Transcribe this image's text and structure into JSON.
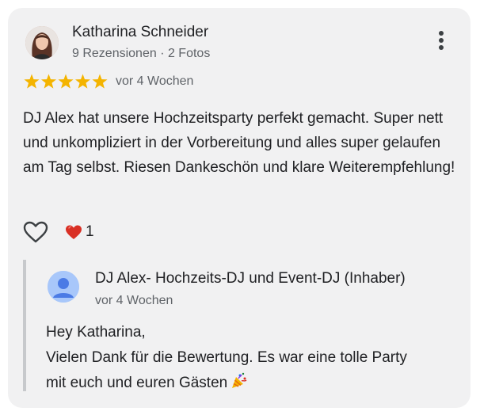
{
  "review": {
    "author_name": "Katharina Schneider",
    "author_meta": "9 Rezensionen · 2 Fotos",
    "rating": 5,
    "rating_max": 5,
    "date": "vor 4 Wochen",
    "text": "DJ Alex hat unsere Hochzeitsparty perfekt gemacht. Super nett und unkompliziert in der Vorbereitung und alles super gelaufen am Tag selbst. Riesen Dankeschön und klare Weiterempfehlung!",
    "reaction_count": "1"
  },
  "reply": {
    "owner_name": "DJ Alex- Hochzeits-DJ und Event-DJ (Inhaber)",
    "date": "vor 4 Wochen",
    "greeting": "Hey Katharina,",
    "line2": "Vielen Dank für die Bewertung. Es war eine tolle Party",
    "line3": "mit euch und euren Gästen"
  },
  "colors": {
    "card_background": "#f1f1f2",
    "star": "#f4b400",
    "heart_reaction": "#d93025",
    "owner_avatar": "#a8c7fa",
    "owner_avatar_figure": "#4b7be5"
  },
  "icons": {
    "more": "more-vert-icon",
    "like": "heart-outline-icon",
    "reaction": "red-heart-icon",
    "party": "party-popper-icon"
  }
}
